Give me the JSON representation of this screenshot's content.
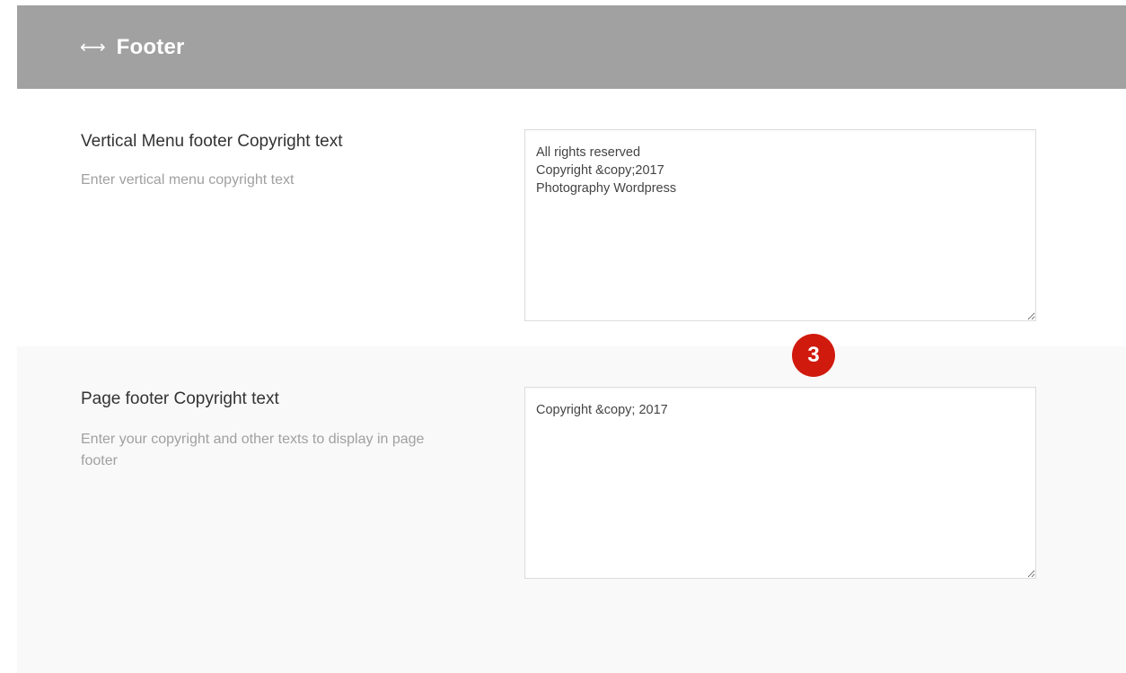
{
  "section": {
    "icon": "arrows-horizontal-icon",
    "icon_glyph": "⟷",
    "title": "Footer"
  },
  "options": [
    {
      "title": "Vertical Menu footer Copyright text",
      "description": "Enter vertical menu copyright text",
      "value": "All rights reserved\nCopyright &copy;2017\nPhotography Wordpress"
    },
    {
      "title": "Page footer Copyright text",
      "description": "Enter your copyright and other texts to display in page footer",
      "value": "Copyright &copy; 2017"
    }
  ],
  "annotation": {
    "step_number": "3",
    "color": "#d11a0e"
  },
  "colors": {
    "header_bg": "#a1a1a1",
    "alt_row_bg": "#f9f9f9"
  }
}
